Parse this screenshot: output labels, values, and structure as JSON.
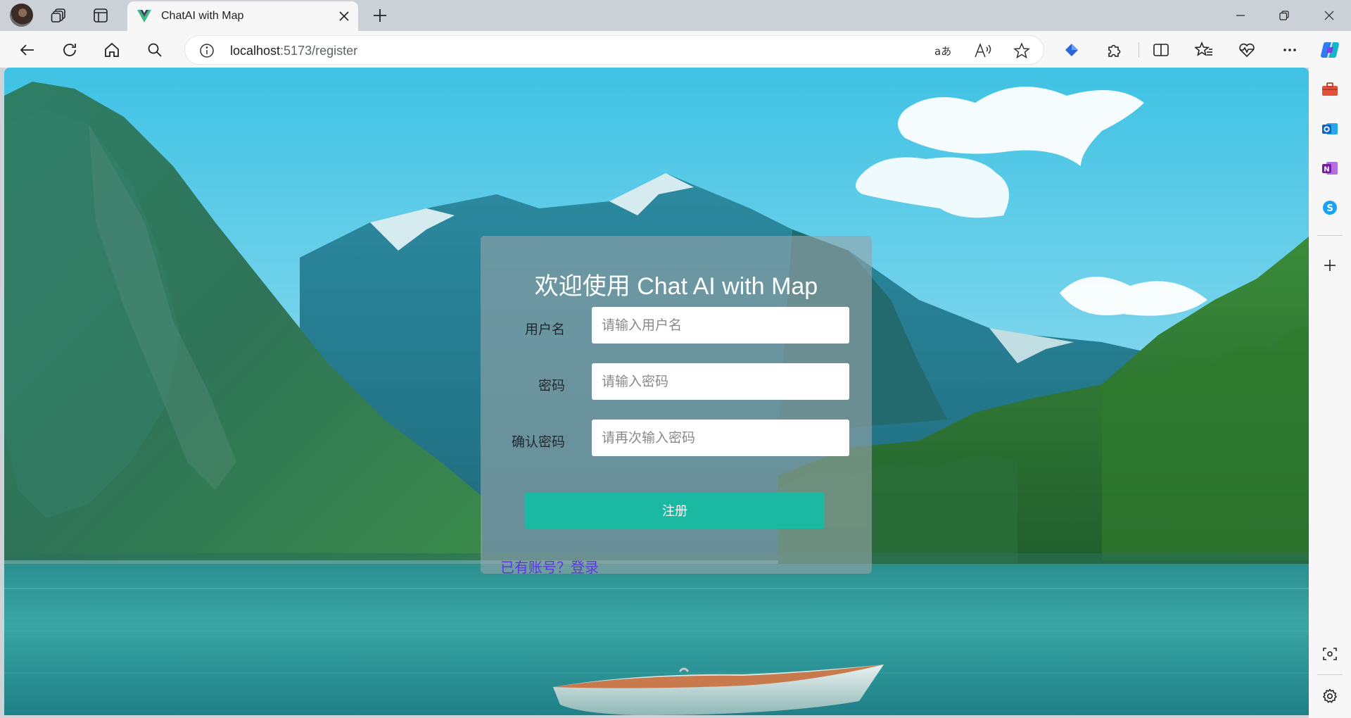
{
  "browser": {
    "tab_title": "ChatAI with Map",
    "url_host": "localhost",
    "url_rest": ":5173/register",
    "icons": {
      "profile": "avatar",
      "workspaces": "workspaces-icon",
      "tab_actions": "tab-actions-icon",
      "new_tab": "plus-icon",
      "back": "back-arrow-icon",
      "reload": "reload-icon",
      "home": "home-icon",
      "search": "search-icon",
      "site_info": "info-icon",
      "translate": "translate-icon",
      "read_aloud": "read-aloud-icon",
      "favorite": "star-icon",
      "extensions": "puzzle-icon",
      "split_screen": "split-screen-icon",
      "favorites": "favorites-icon",
      "browser_essentials": "heart-pulse-icon",
      "more": "more-icon",
      "copilot": "copilot-icon"
    },
    "sidebar_icons": [
      "toolbox-icon",
      "outlook-icon",
      "onenote-icon",
      "skype-icon",
      "plus-icon",
      "screenshot-icon",
      "gear-icon"
    ],
    "colors": {
      "tabbar": "#ccd1d7",
      "toolbar": "#f7f7f7"
    }
  },
  "page": {
    "title": "欢迎使用 Chat AI with Map",
    "form": {
      "username_label": "用户名",
      "username_placeholder": "请输入用户名",
      "password_label": "密码",
      "password_placeholder": "请输入密码",
      "confirm_label": "确认密码",
      "confirm_placeholder": "请再次输入密码",
      "submit_label": "注册"
    },
    "login_link": "已有账号？登录",
    "colors": {
      "accent": "#1bb9a1",
      "link": "#5b38e0",
      "card": "rgba(150,165,170,0.62)"
    }
  }
}
